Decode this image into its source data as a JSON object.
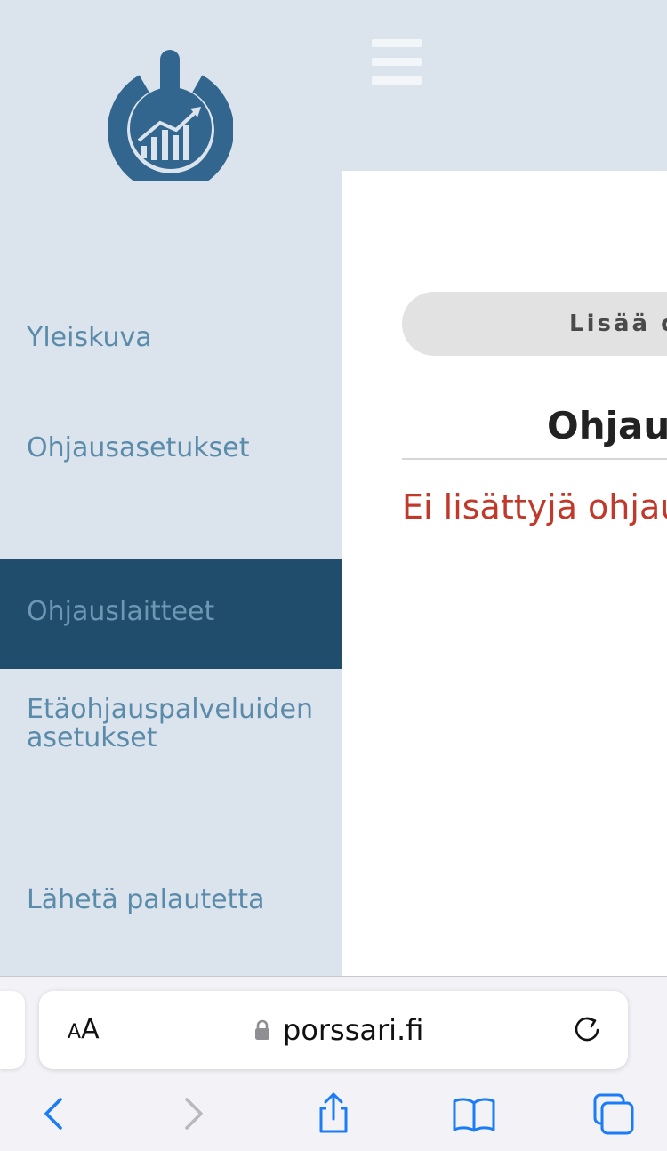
{
  "sidebar": {
    "logo_icon": "power-chart-logo-icon",
    "items": [
      {
        "label": "Yleiskuva"
      },
      {
        "label": "Ohjausasetukset"
      },
      {
        "label": "Ohjauslaitteet",
        "active": true
      },
      {
        "label": "Etäohjauspalveluiden asetukset"
      },
      {
        "label": "Lähetä palautetta"
      }
    ]
  },
  "header": {
    "menu_icon": "hamburger-icon"
  },
  "main": {
    "add_button_label": "Lisää ohjauslaite",
    "heading": "Ohjauslaitteet",
    "empty_message": "Ei lisättyjä ohjauslaitteita"
  },
  "browser": {
    "text_size_label_small": "A",
    "text_size_label_large": "A",
    "url": "porssari.fi",
    "icons": [
      "lock-icon",
      "reload-icon",
      "back-icon",
      "forward-icon",
      "share-icon",
      "bookmarks-icon",
      "tabs-icon"
    ]
  },
  "colors": {
    "sidebar_bg": "#dbe3ec",
    "active_item_bg": "#1f4d6b",
    "nav_text": "#5a8bab",
    "brand": "#33668f",
    "error_text": "#c0392b",
    "ios_blue": "#1a7cf6"
  }
}
